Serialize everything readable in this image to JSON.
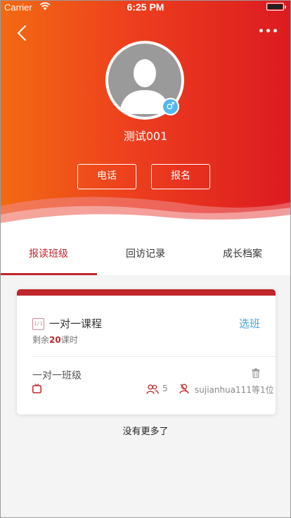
{
  "status_bar": {
    "carrier": "Carrier",
    "time": "6:25 PM"
  },
  "profile": {
    "name": "测试001",
    "gender_symbol": "♂",
    "call_label": "电话",
    "signup_label": "报名"
  },
  "tabs": [
    {
      "label": "报读班级",
      "active": true
    },
    {
      "label": "回访记录",
      "active": false
    },
    {
      "label": "成长档案",
      "active": false
    }
  ],
  "course": {
    "icon_text": "1/1",
    "title": "一对一课程",
    "choose_label": "选班",
    "remaining_prefix": "剩余",
    "remaining_count": "20",
    "remaining_suffix": "课时"
  },
  "class": {
    "name": "一对一班级",
    "students_count": "5",
    "teacher_text": "sujianhua111等1位"
  },
  "footer": {
    "no_more": "没有更多了"
  },
  "colors": {
    "header_start": "#f36a12",
    "header_end": "#dc1a20",
    "accent_red": "#c0262b",
    "link_blue": "#4aa5e0",
    "badge_blue": "#54b8ec"
  }
}
